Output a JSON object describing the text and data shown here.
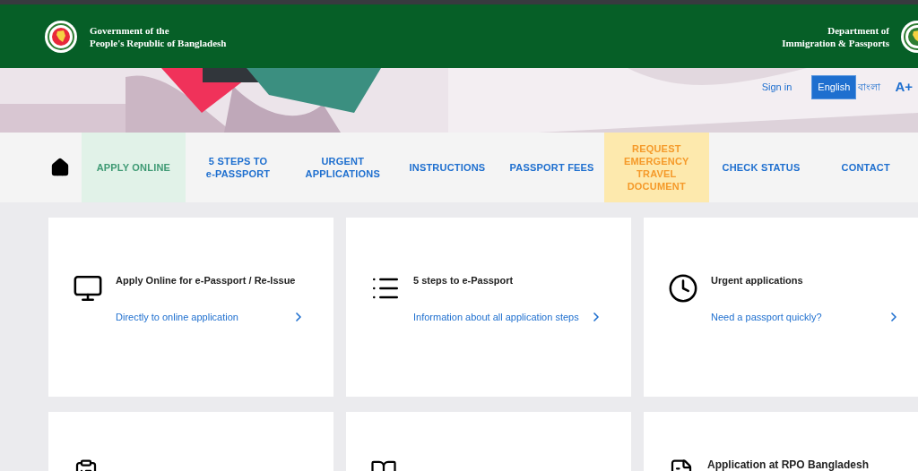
{
  "header": {
    "government": [
      "Government of the",
      "People's Republic of Bangladesh"
    ],
    "department": [
      "Department of",
      "Immigration & Passports"
    ]
  },
  "banner": {
    "kind": "picture",
    "sign_in": "Sign in",
    "languages": [
      {
        "label": "English",
        "selected": true
      },
      {
        "label": "বাংলা",
        "selected": false
      }
    ],
    "font_size": "A+"
  },
  "nav": [
    {
      "label": "APPLY ONLINE",
      "selected": true,
      "kind": "normal"
    },
    {
      "label": "5 STEPS TO\ne-PASSPORT",
      "selected": false,
      "kind": "normal"
    },
    {
      "label": "URGENT\nAPPLICATIONS",
      "selected": false,
      "kind": "normal"
    },
    {
      "label": "INSTRUCTIONS",
      "selected": false,
      "kind": "normal"
    },
    {
      "label": "PASSPORT FEES",
      "selected": false,
      "kind": "normal"
    },
    {
      "label": "REQUEST\nEMERGENCY\nTRAVEL\nDOCUMENT",
      "selected": false,
      "kind": "emergency"
    },
    {
      "label": "CHECK STATUS",
      "selected": false,
      "kind": "normal"
    },
    {
      "label": "CONTACT",
      "selected": false,
      "kind": "normal"
    }
  ],
  "cards": [
    {
      "title": "Apply Online for e-Passport / Re-Issue",
      "link": "Directly to online application"
    },
    {
      "title": "5 steps to e-Passport",
      "link": "Information about all application steps"
    },
    {
      "title": "Urgent applications",
      "link": "Need a passport quickly?"
    }
  ],
  "lower_cards": [
    {
      "kind": "untitled"
    },
    {
      "kind": "untitled"
    },
    {
      "kind": "titled",
      "title": "Application at RPO Bangladesh"
    }
  ]
}
